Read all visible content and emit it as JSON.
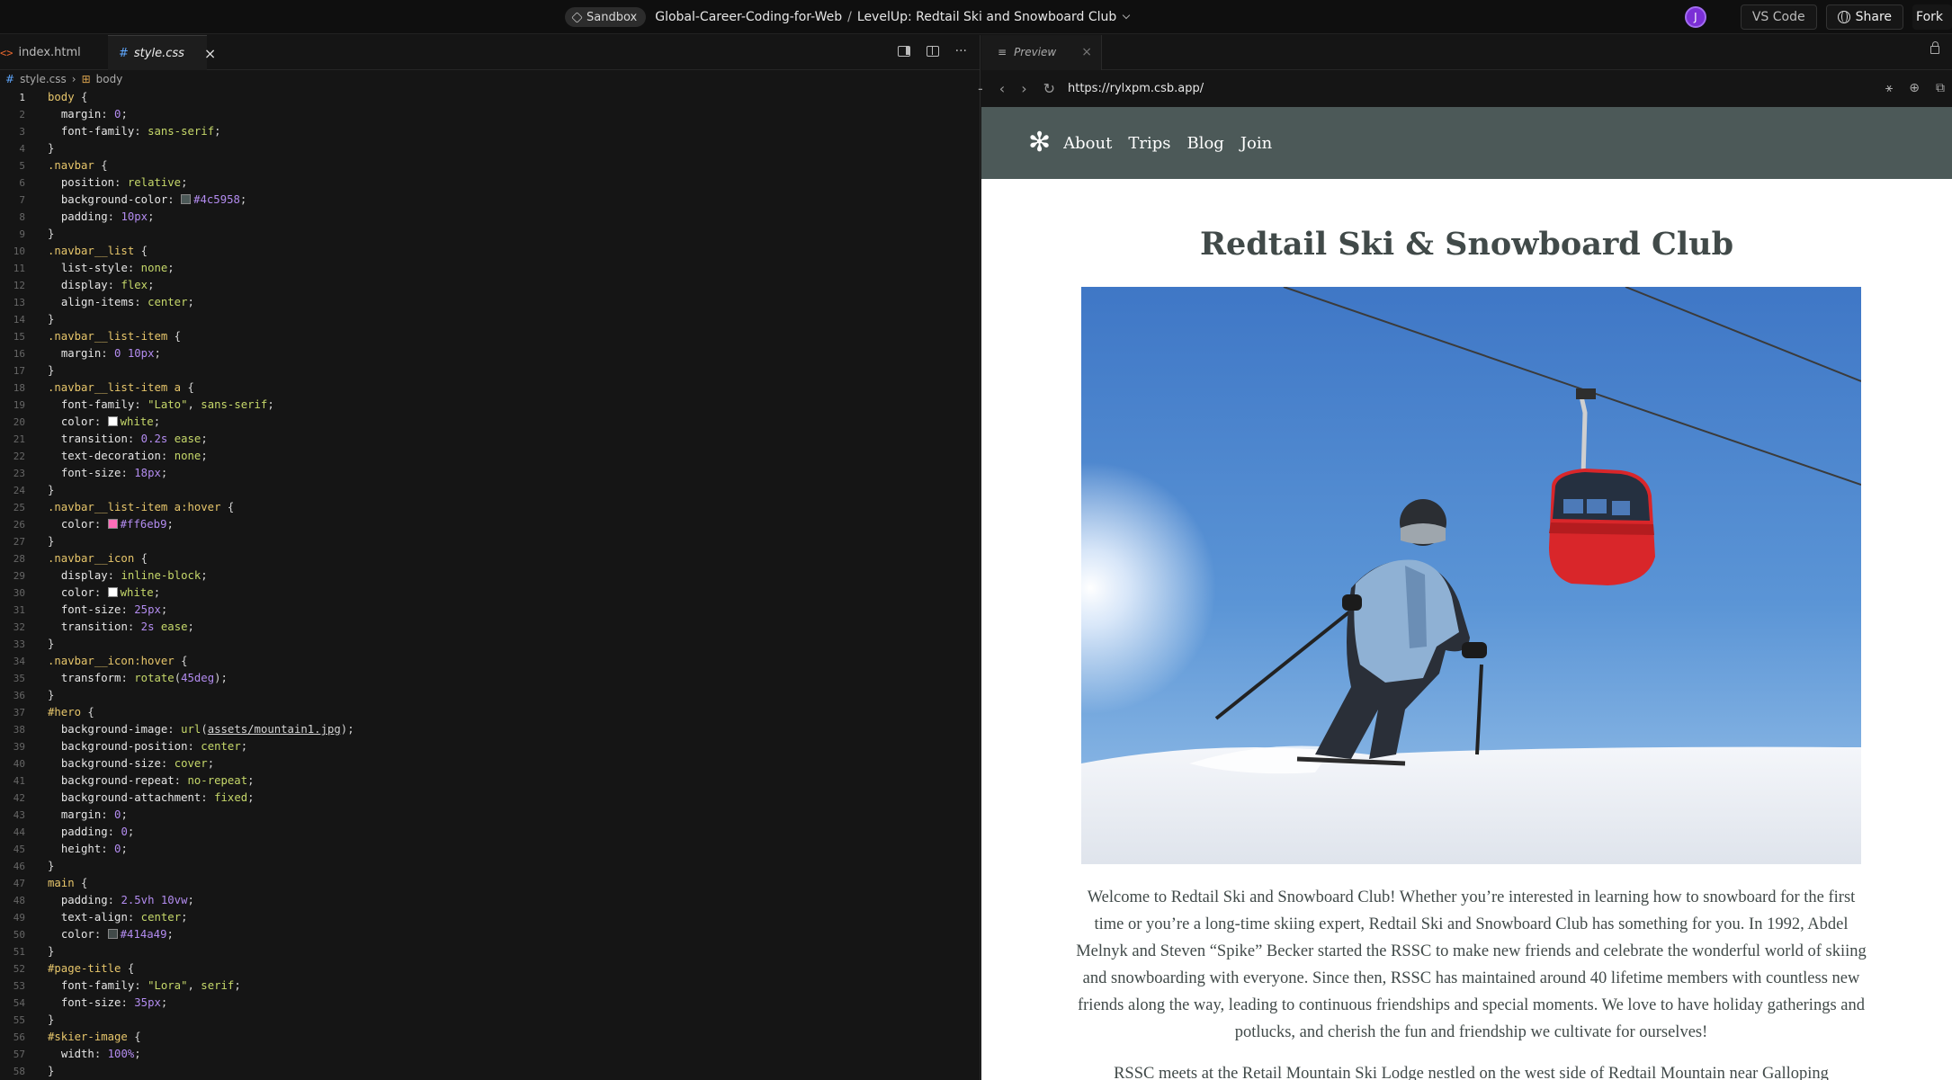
{
  "topbar": {
    "sandbox_label": "Sandbox",
    "workspace": "Global-Career-Coding-for-Web",
    "separator": "/",
    "project": "LevelUp: Redtail Ski and Snowboard Club",
    "avatar_initial": "J",
    "vscode_label": "VS Code",
    "share_label": "Share",
    "fork_label": "Fork"
  },
  "editor": {
    "tabs": [
      {
        "label": "index.html",
        "icon": "html-file-icon"
      },
      {
        "label": "style.css",
        "icon": "css-file-icon"
      }
    ],
    "breadcrumb": {
      "file": "style.css",
      "symbol": "body"
    }
  },
  "preview": {
    "tab_label": "Preview",
    "url": "https://rylxpm.csb.app/"
  },
  "site": {
    "nav_icon": "✻",
    "nav_links": [
      "About",
      "Trips",
      "Blog",
      "Join"
    ],
    "title": "Redtail Ski & Snowboard Club",
    "paragraph1": "Welcome to Redtail Ski and Snowboard Club! Whether you’re interested in learning how to snowboard for the first time or you’re a long-time skiing expert, Redtail Ski and Snowboard Club has something for you. In 1992, Abdel Melnyk and Steven “Spike” Becker started the RSSC to make new friends and celebrate the wonderful world of skiing and snowboarding with everyone. Since then, RSSC has maintained around 40 lifetime members with countless new friends along the way, leading to continuous friendships and special moments. We love to have holiday gatherings and potlucks, and cherish the fun and friendship we cultivate for ourselves!",
    "paragraph2": "RSSC meets at the Retail Mountain Ski Lodge nestled on the west side of Redtail Mountain near Galloping"
  },
  "colors": {
    "navbar_bg": "#4c5958",
    "text": "#414a49",
    "hover": "#ff6eb9"
  }
}
